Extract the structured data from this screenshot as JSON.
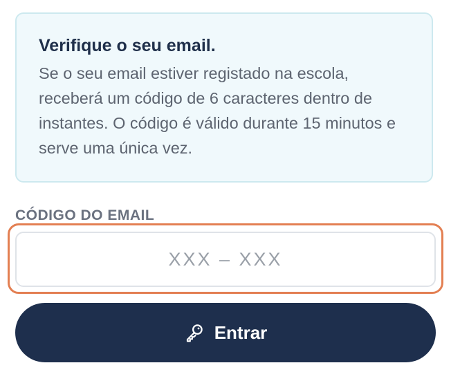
{
  "notice": {
    "title": "Verifique o seu email.",
    "body": "Se o seu email estiver registado na escola, receberá um código de 6 caracteres dentro de instantes. O código é válido durante 15 minutos e serve uma única vez."
  },
  "code_field": {
    "label": "CÓDIGO DO EMAIL",
    "placeholder": "XXX – XXX",
    "value": ""
  },
  "submit": {
    "icon": "key-icon",
    "label": "Entrar"
  },
  "colors": {
    "focus_ring": "#e37f52",
    "primary_button": "#1e2f4d",
    "notice_background": "#f0f9fc"
  }
}
